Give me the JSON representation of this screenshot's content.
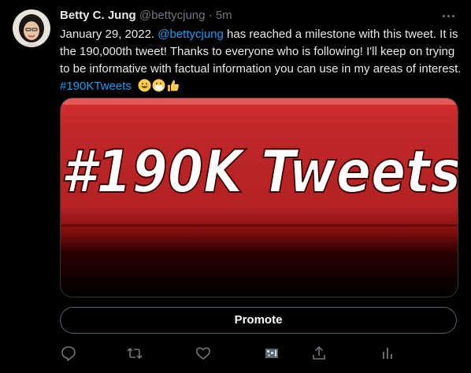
{
  "author": {
    "name": "Betty C. Jung",
    "handle": "@bettycjung",
    "separator": "·",
    "time": "5m"
  },
  "tweet": {
    "text_part1": "January 29, 2022. ",
    "mention": "@bettycjung",
    "text_part2": " has reached a milestone with this tweet. It is the 190,000th tweet! Thanks to everyone who is following! I'll keep on trying to be informative with factual information you can use in my areas of interest. ",
    "hashtag": "#190KTweets",
    "emojis": [
      "grinning-face",
      "face-with-medical-mask",
      "thumbs-up"
    ]
  },
  "media": {
    "image_text": "#190K Tweets",
    "colors": {
      "banner_red": "#c0282a",
      "banner_dark": "#1a0000",
      "text_white": "#ffffff"
    }
  },
  "promote_label": "Promote",
  "actions": [
    "reply-icon",
    "retweet-icon",
    "like-icon",
    "analytics-icon",
    "share-icon",
    "activity-icon"
  ],
  "colors": {
    "background": "#000000",
    "text": "#e7e9ea",
    "secondary_text": "#71767b",
    "link": "#1d9bf0"
  }
}
